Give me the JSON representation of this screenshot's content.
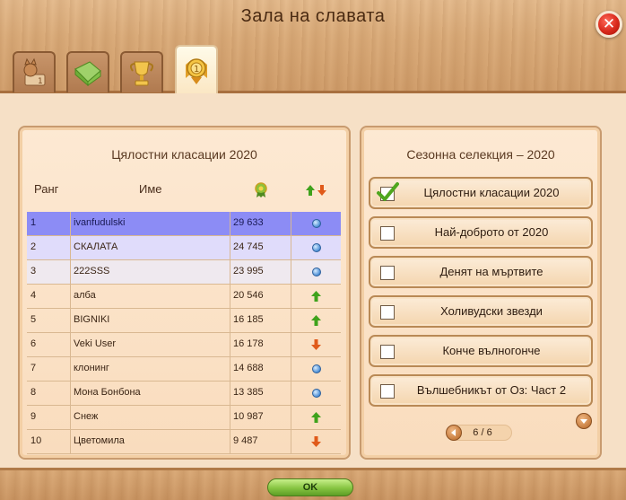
{
  "window": {
    "title": "Зала на славата",
    "close_label": "✕"
  },
  "tabs": [
    {
      "icon": "cat-trophy-icon",
      "active": false
    },
    {
      "icon": "green-cloth-icon",
      "active": false
    },
    {
      "icon": "golden-trophy-icon",
      "active": false
    },
    {
      "icon": "gold-medal-icon",
      "active": true
    }
  ],
  "leaderboard": {
    "title": "Цялостни класации 2020",
    "headers": {
      "rank": "Ранг",
      "name": "Име"
    },
    "score_icon": "award-ribbon-icon",
    "trend_icon": "up-down-arrows-icon",
    "rows": [
      {
        "rank": "1",
        "name": "ivanfudulski",
        "score": "29 633",
        "trend": "same"
      },
      {
        "rank": "2",
        "name": "СКАЛАТА",
        "score": "24 745",
        "trend": "same"
      },
      {
        "rank": "3",
        "name": "222SSS",
        "score": "23 995",
        "trend": "same"
      },
      {
        "rank": "4",
        "name": "алба",
        "score": "20 546",
        "trend": "up"
      },
      {
        "rank": "5",
        "name": "BIGNIKI",
        "score": "16 185",
        "trend": "up"
      },
      {
        "rank": "6",
        "name": "Veki User",
        "score": "16 178",
        "trend": "down"
      },
      {
        "rank": "7",
        "name": "клонинг",
        "score": "14 688",
        "trend": "same"
      },
      {
        "rank": "8",
        "name": "Мона Бонбона",
        "score": "13 385",
        "trend": "same"
      },
      {
        "rank": "9",
        "name": "Снеж",
        "score": "10 987",
        "trend": "up"
      },
      {
        "rank": "10",
        "name": "Цветомила",
        "score": "9 487",
        "trend": "down"
      }
    ]
  },
  "season": {
    "title": "Сезонна селекция – 2020",
    "items": [
      {
        "label": "Цялостни класации 2020",
        "checked": true
      },
      {
        "label": "Най-доброто от 2020",
        "checked": false
      },
      {
        "label": "Денят на мъртвите",
        "checked": false
      },
      {
        "label": "Холивудски звезди",
        "checked": false
      },
      {
        "label": "Конче вълногонче",
        "checked": false
      },
      {
        "label": "Вълшебникът от Оз: Част 2",
        "checked": false
      }
    ],
    "pager": "6 / 6"
  },
  "footer": {
    "ok_label": "OK"
  },
  "colors": {
    "highlight_first": "#8c8cf5",
    "highlight_second": "#e0dcfb",
    "trend_up": "#3fa21c",
    "trend_down": "#e05a1a"
  }
}
